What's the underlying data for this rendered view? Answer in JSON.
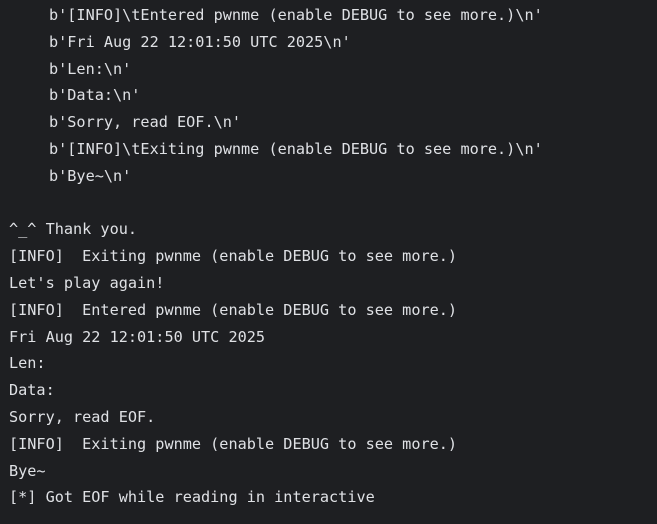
{
  "terminal": {
    "indented_lines": [
      "b'[INFO]\\tEntered pwnme (enable DEBUG to see more.)\\n'",
      "b'Fri Aug 22 12:01:50 UTC 2025\\n'",
      "b'Len:\\n'",
      "b'Data:\\n'",
      "b'Sorry, read EOF.\\n'",
      "b'[INFO]\\tExiting pwnme (enable DEBUG to see more.)\\n'",
      "b'Bye~\\n'"
    ],
    "lines": [
      "^_^ Thank you.",
      "[INFO]  Exiting pwnme (enable DEBUG to see more.)",
      "Let's play again!",
      "[INFO]  Entered pwnme (enable DEBUG to see more.)",
      "Fri Aug 22 12:01:50 UTC 2025",
      "Len:",
      "Data:",
      "Sorry, read EOF.",
      "[INFO]  Exiting pwnme (enable DEBUG to see more.)",
      "Bye~",
      "[*] Got EOF while reading in interactive"
    ]
  }
}
